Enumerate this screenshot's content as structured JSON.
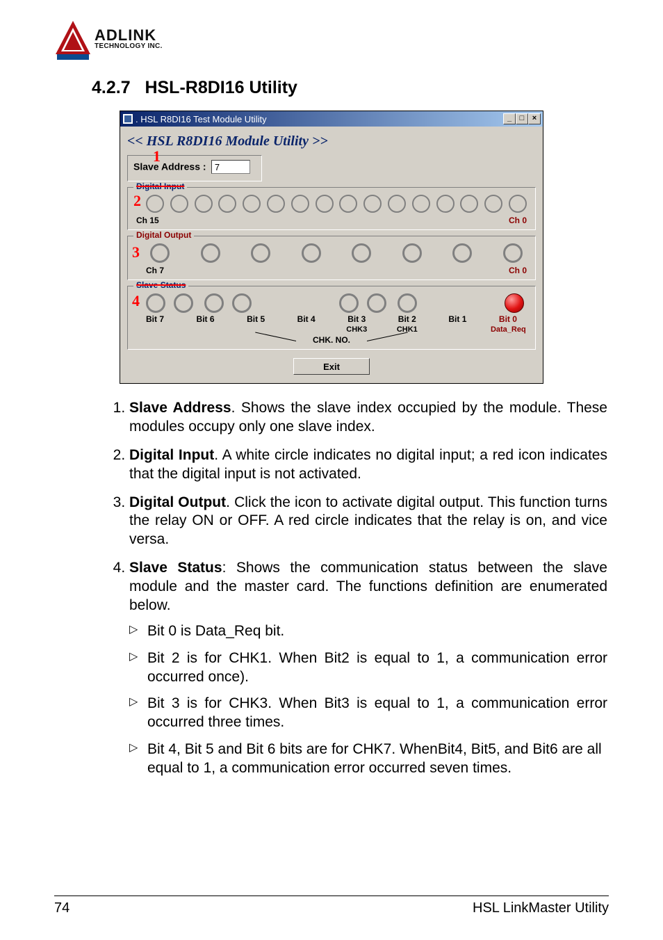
{
  "logo": {
    "brand": "ADLINK",
    "tag": "TECHNOLOGY INC."
  },
  "section": {
    "number": "4.2.7",
    "title": "HSL-R8DI16 Utility"
  },
  "window": {
    "title": ". HSL R8DI16  Test Module Utility",
    "min": "_",
    "max": "□",
    "close": "×",
    "app_title": "<< HSL R8DI16  Module Utility >>",
    "slave_label": "Slave Address :",
    "slave_value": "7",
    "callouts": {
      "c1": "1",
      "c2": "2",
      "c3": "3",
      "c4": "4"
    },
    "di": {
      "legend": "Digital Input",
      "left": "Ch 15",
      "right": "Ch 0"
    },
    "do": {
      "legend": "Digital Output",
      "left": "Ch 7",
      "right": "Ch 0"
    },
    "status": {
      "legend": "Slave Status",
      "bits": [
        "Bit 7",
        "Bit 6",
        "Bit 5",
        "Bit 4",
        "Bit 3",
        "Bit 2",
        "Bit 1",
        "Bit 0"
      ],
      "subs": [
        "",
        "",
        "",
        "",
        "CHK3",
        "CHK1",
        "",
        "Data_Req"
      ],
      "chk_no": "CHK. NO."
    },
    "exit": "Exit"
  },
  "list": {
    "i1_b": "Slave Address",
    "i1_t": ". Shows the slave index occupied by the module. These modules occupy only one slave index.",
    "i2_b": "Digital Input",
    "i2_t": ". A white circle indicates no digital input; a red icon indicates that the digital input is not activated.",
    "i3_b": "Digital Output",
    "i3_t": ". Click the icon to activate digital output. This function turns the relay ON or OFF. A red circle indicates that the relay is on, and vice versa.",
    "i4_b": "Slave Status",
    "i4_t": ": Shows the communication status between the slave module and the master card. The functions definition are enumerated below.",
    "s1": "Bit 0 is Data_Req bit.",
    "s2": "Bit 2 is for CHK1. When Bit2 is equal to 1, a communication error occurred once).",
    "s3": "Bit 3 is for CHK3. When Bit3 is equal to 1, a communication error occurred three times.",
    "s4": "Bit 4, Bit 5 and Bit 6 bits are for CHK7. WhenBit4, Bit5, and Bit6 are all equal to 1, a communication error occurred seven times."
  },
  "footer": {
    "page": "74",
    "title": "HSL LinkMaster Utility"
  }
}
